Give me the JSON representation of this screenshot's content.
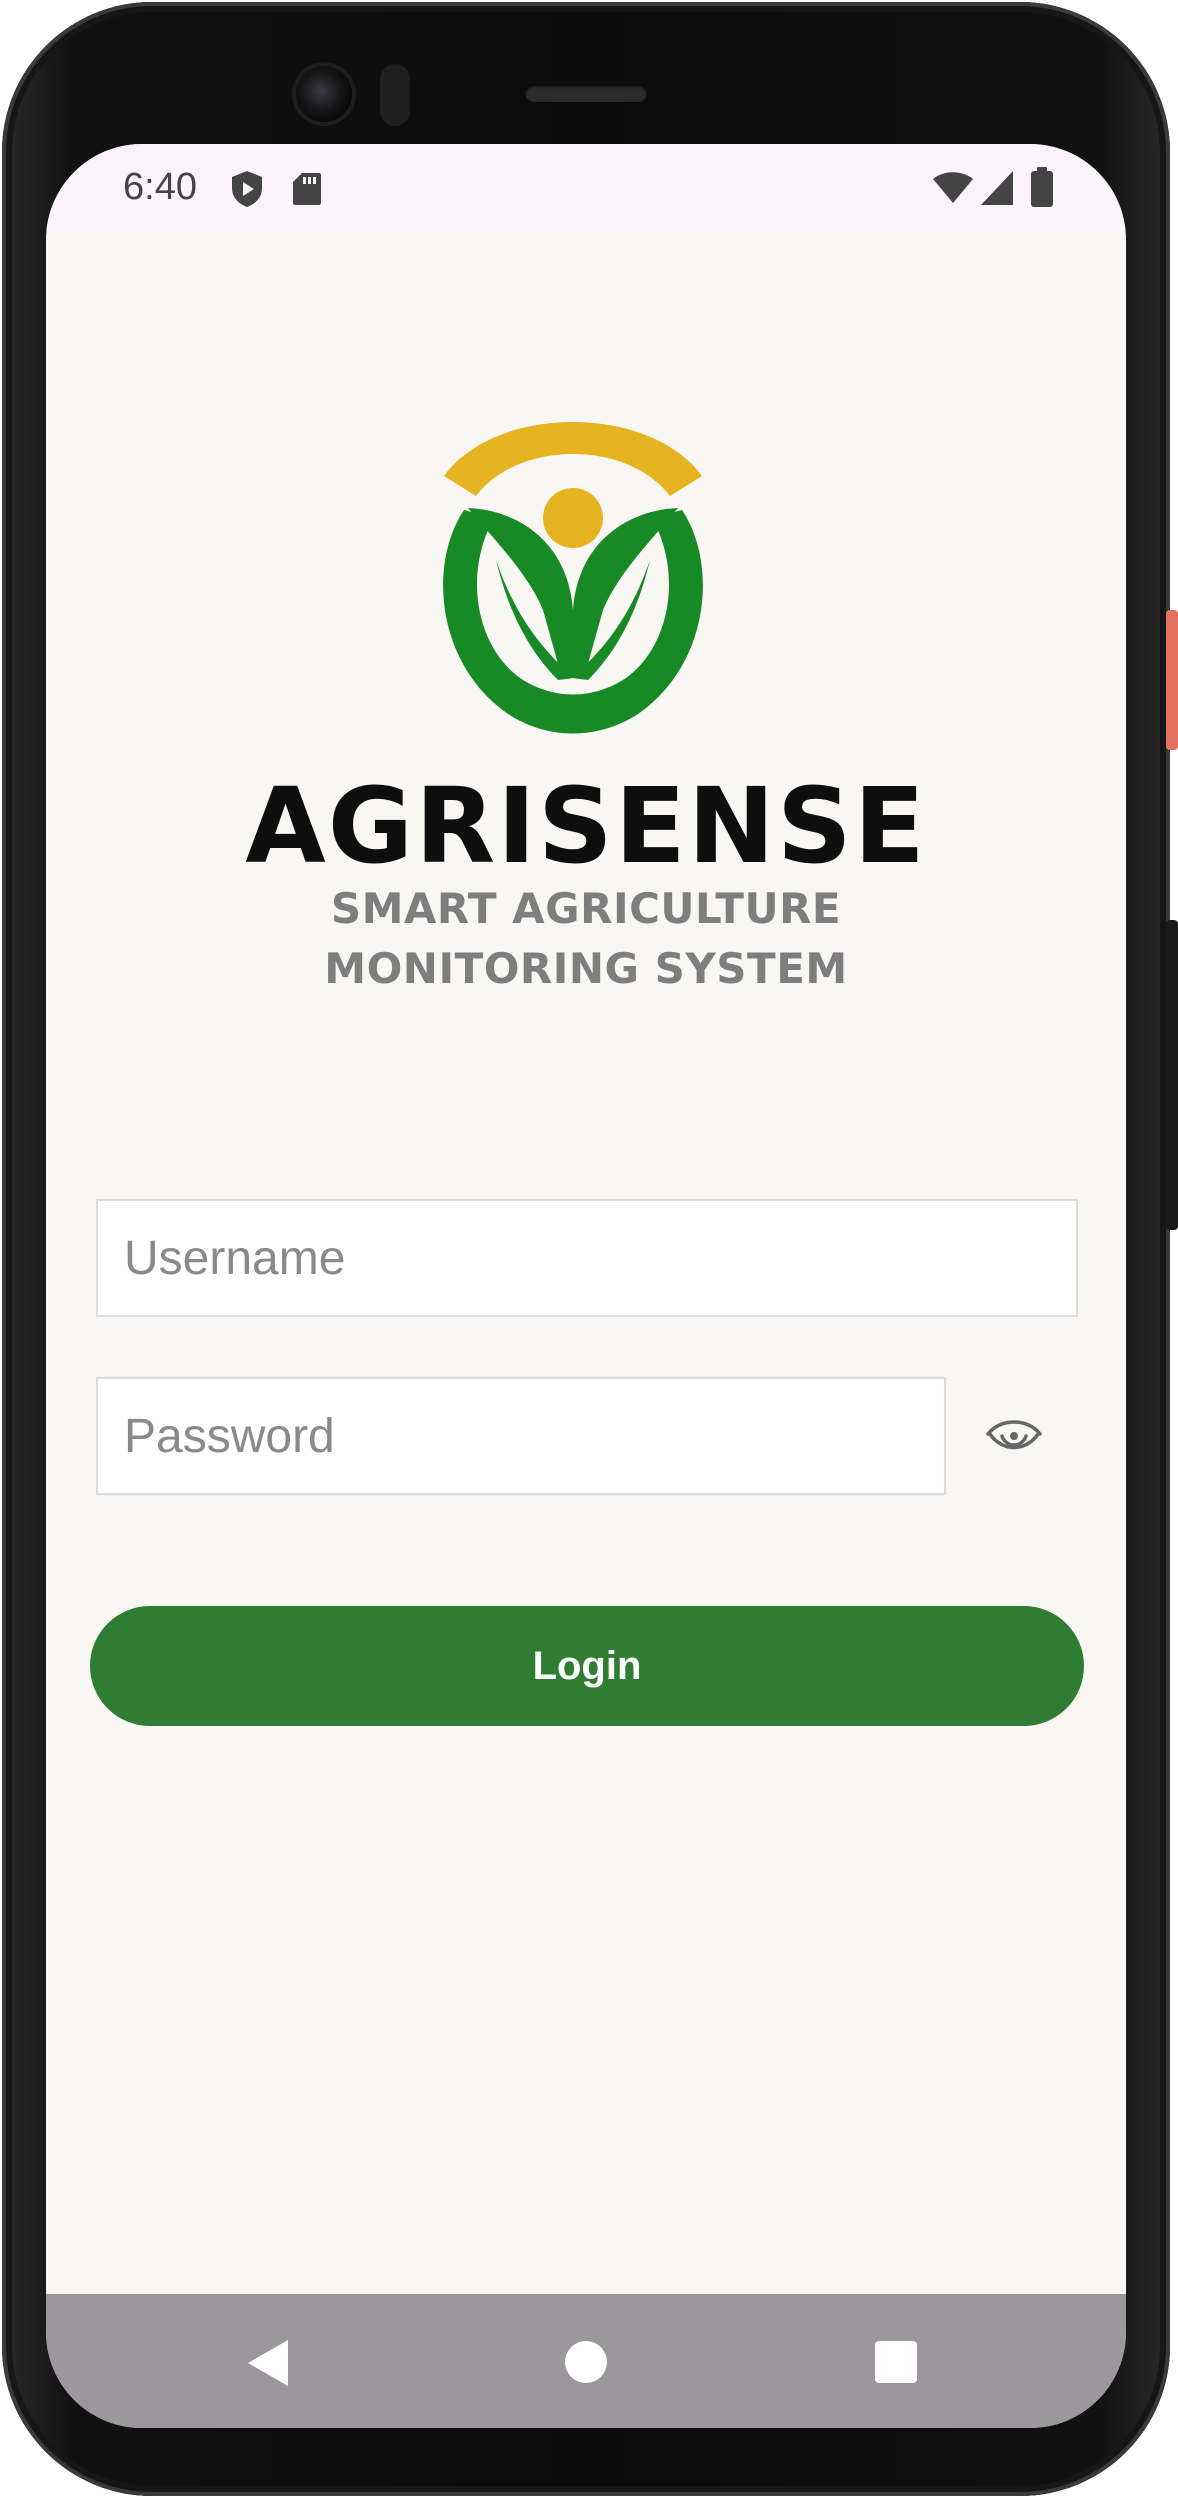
{
  "status_bar": {
    "time": "6:40",
    "left_icons": [
      "shield-play-icon",
      "sd-card-icon"
    ],
    "right_icons": [
      "wifi-icon",
      "cell-signal-icon",
      "battery-icon"
    ]
  },
  "logo": {
    "name": "AGRISENSE",
    "tagline_line1": "SMART AGRICULTURE",
    "tagline_line2": "MONITORING SYSTEM",
    "colors": {
      "sun": "#e6b420",
      "leaf": "#178a25"
    }
  },
  "form": {
    "username_placeholder": "Username",
    "password_placeholder": "Password",
    "password_toggle_icon": "eye-icon",
    "login_label": "Login"
  },
  "nav_bar": {
    "buttons": [
      "back-icon",
      "home-icon",
      "recents-icon"
    ]
  },
  "colors": {
    "primary": "#2e7d32",
    "background": "#f8f7f4",
    "status_bar": "#fcf4fc",
    "nav_bar": "#9b979c"
  }
}
